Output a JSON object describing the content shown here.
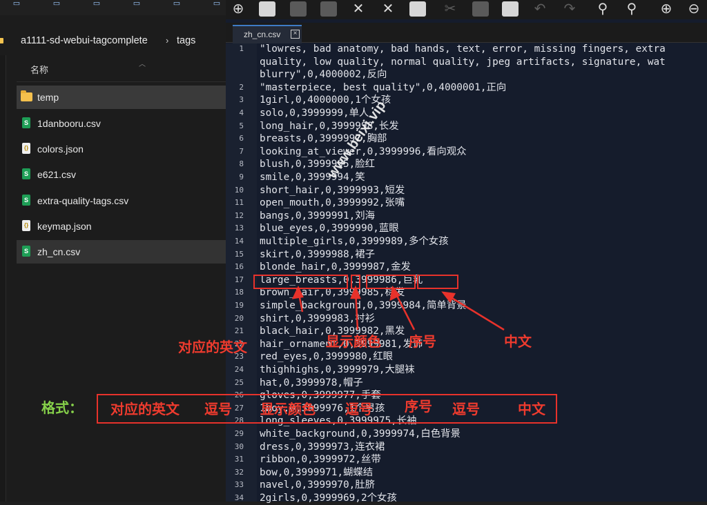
{
  "explorer": {
    "breadcrumb": [
      "a1111-sd-webui-tagcomplete",
      "tags"
    ],
    "breadcrumb_sep": "›",
    "column_header": "名称",
    "files": [
      {
        "name": "temp",
        "type": "folder"
      },
      {
        "name": "1danbooru.csv",
        "type": "csv"
      },
      {
        "name": "colors.json",
        "type": "json"
      },
      {
        "name": "e621.csv",
        "type": "csv"
      },
      {
        "name": "extra-quality-tags.csv",
        "type": "csv"
      },
      {
        "name": "keymap.json",
        "type": "json"
      },
      {
        "name": "zh_cn.csv",
        "type": "csv"
      }
    ]
  },
  "editor": {
    "tab": {
      "name": "zh_cn.csv",
      "close": "×"
    },
    "line_numbers": [
      "1",
      "",
      "",
      "2",
      "3",
      "4",
      "5",
      "6",
      "7",
      "8",
      "9",
      "10",
      "11",
      "12",
      "13",
      "14",
      "15",
      "16",
      "17",
      "18",
      "19",
      "20",
      "21",
      "22",
      "23",
      "24",
      "25",
      "26",
      "27",
      "28",
      "29",
      "30",
      "31",
      "32",
      "33",
      "34"
    ],
    "lines": [
      "\"lowres, bad anatomy, bad hands, text, error, missing fingers, extra",
      "quality, low quality, normal quality, jpeg artifacts, signature, wat",
      "blurry\",0,4000002,反向",
      "\"masterpiece, best quality\",0,4000001,正向",
      "1girl,0,4000000,1个女孩",
      "solo,0,3999999,单人",
      "long_hair,0,3999998,长发",
      "breasts,0,3999997,胸部",
      "looking_at_viewer,0,3999996,看向观众",
      "blush,0,3999995,脸红",
      "smile,0,3999994,笑",
      "short_hair,0,3999993,短发",
      "open_mouth,0,3999992,张嘴",
      "bangs,0,3999991,刘海",
      "blue_eyes,0,3999990,蓝眼",
      "multiple_girls,0,3999989,多个女孩",
      "skirt,0,3999988,裙子",
      "blonde_hair,0,3999987,金发",
      "large_breasts,0,3999986,巨乳",
      "brown_hair,0,3999985,棕发",
      "simple_background,0,3999984,简单背景",
      "shirt,0,3999983,衬衫",
      "black_hair,0,3999982,黑发",
      "hair_ornament,0,3999981,发饰",
      "red_eyes,0,3999980,红眼",
      "thighhighs,0,3999979,大腿袜",
      "hat,0,3999978,帽子",
      "gloves,0,3999977,手套",
      "1boy,0,3999976,1个男孩",
      "long_sleeves,0,3999975,长袖",
      "white_background,0,3999974,白色背景",
      "dress,0,3999973,连衣裙",
      "ribbon,0,3999972,丝带",
      "bow,0,3999971,蝴蝶结",
      "navel,0,3999970,肚脐",
      "2girls,0,3999969,2个女孩"
    ]
  },
  "annotations": {
    "english": "对应的英文",
    "color": "显示颜色",
    "order": "序号",
    "chinese": "中文",
    "format_label": "格式：",
    "format_items": [
      "对应的英文",
      "逗号",
      "显示颜色",
      "逗号",
      "序号",
      "逗号",
      "中文"
    ],
    "watermark": "www.beixi.vip"
  },
  "colors": {
    "annotation_red": "#e8322b",
    "format_green": "#86d14a",
    "editor_bg": "#151c2c"
  }
}
